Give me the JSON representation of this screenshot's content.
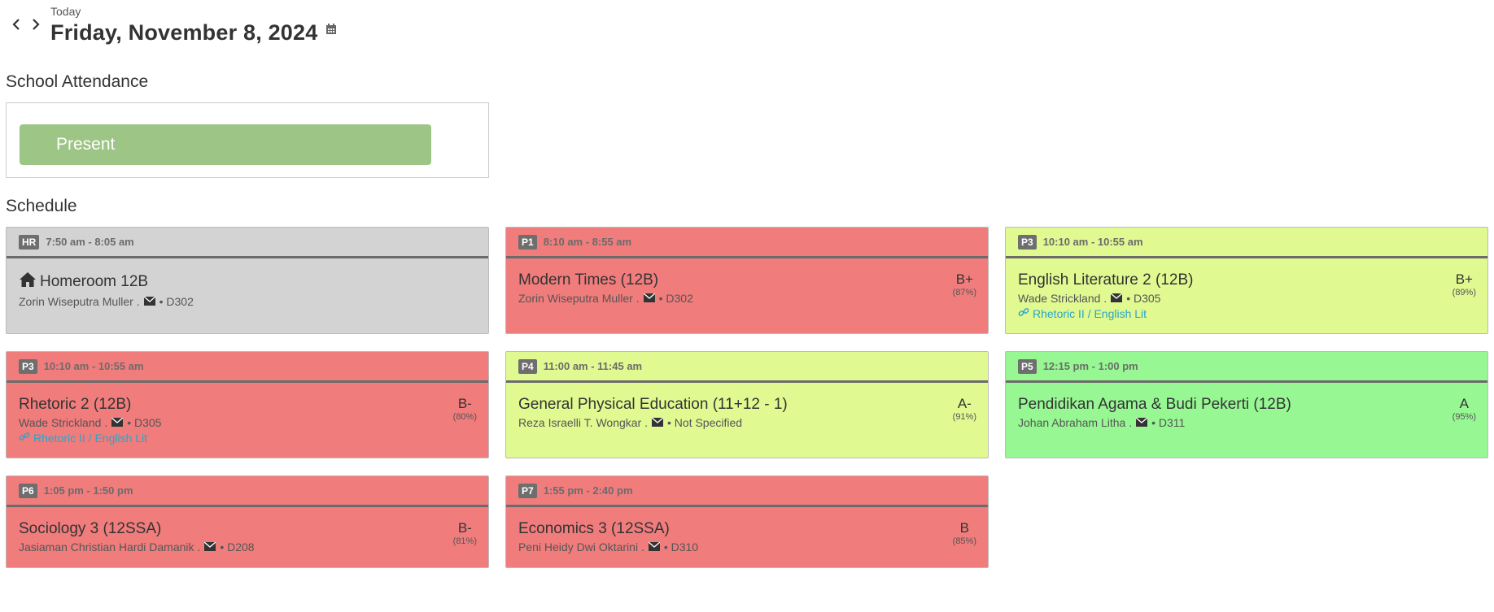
{
  "header": {
    "today_label": "Today",
    "date": "Friday, November 8, 2024"
  },
  "attendance": {
    "title": "School Attendance",
    "status": "Present",
    "status_color": "#9dc585"
  },
  "schedule": {
    "title": "Schedule",
    "classes": [
      {
        "period": "HR",
        "time": "7:50 am - 8:05 am",
        "name": "Homeroom 12B",
        "teacher": "Zorin Wiseputra Muller .",
        "room": "• D302",
        "grade": "",
        "pct": "",
        "link": "",
        "color": "#d3d3d3"
      },
      {
        "period": "P1",
        "time": "8:10 am - 8:55 am",
        "name": "Modern Times (12B)",
        "teacher": "Zorin Wiseputra Muller .",
        "room": "• D302",
        "grade": "B+",
        "pct": "(87%)",
        "link": "",
        "color": "#f07c7c"
      },
      {
        "period": "P3",
        "time": "10:10 am - 10:55 am",
        "name": "English Literature 2 (12B)",
        "teacher": "Wade Strickland .",
        "room": "• D305",
        "grade": "B+",
        "pct": "(89%)",
        "link": "Rhetoric II / English Lit",
        "color": "#e0f991"
      },
      {
        "period": "P3",
        "time": "10:10 am - 10:55 am",
        "name": "Rhetoric 2 (12B)",
        "teacher": "Wade Strickland .",
        "room": "• D305",
        "grade": "B-",
        "pct": "(80%)",
        "link": "Rhetoric II / English Lit",
        "color": "#f07c7c"
      },
      {
        "period": "P4",
        "time": "11:00 am - 11:45 am",
        "name": "General Physical Education (11+12 - 1)",
        "teacher": "Reza Israelli T. Wongkar .",
        "room": "• Not Specified",
        "grade": "A-",
        "pct": "(91%)",
        "link": "",
        "color": "#e0f991"
      },
      {
        "period": "P5",
        "time": "12:15 pm - 1:00 pm",
        "name": "Pendidikan Agama & Budi Pekerti (12B)",
        "teacher": "Johan Abraham Litha .",
        "room": "• D311",
        "grade": "A",
        "pct": "(95%)",
        "link": "",
        "color": "#97f893"
      },
      {
        "period": "P6",
        "time": "1:05 pm - 1:50 pm",
        "name": "Sociology 3 (12SSA)",
        "teacher": "Jasiaman Christian Hardi Damanik .",
        "room": "• D208",
        "grade": "B-",
        "pct": "(81%)",
        "link": "",
        "color": "#f07c7c"
      },
      {
        "period": "P7",
        "time": "1:55 pm - 2:40 pm",
        "name": "Economics 3 (12SSA)",
        "teacher": "Peni Heidy Dwi Oktarini .",
        "room": "• D310",
        "grade": "B",
        "pct": "(85%)",
        "link": "",
        "color": "#f07c7c"
      }
    ]
  }
}
